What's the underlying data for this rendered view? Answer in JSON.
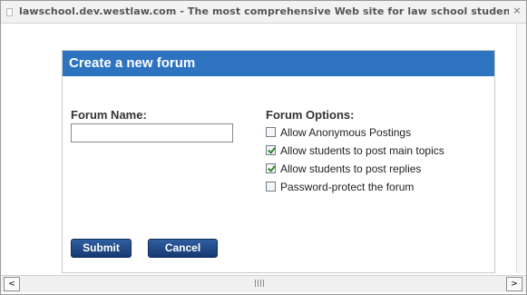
{
  "window": {
    "title": "lawschool.dev.westlaw.com - The most comprehensive Web site for law school students and faculty",
    "close_icon": "close-icon"
  },
  "dialog": {
    "title": "Create a new forum",
    "forum_name_label": "Forum Name:",
    "forum_name_value": "",
    "options_label": "Forum Options:",
    "options": [
      {
        "label": "Allow Anonymous Postings",
        "checked": false
      },
      {
        "label": "Allow students to post main topics",
        "checked": true
      },
      {
        "label": "Allow students to post replies",
        "checked": true
      },
      {
        "label": "Password-protect the forum",
        "checked": false
      }
    ],
    "submit_label": "Submit",
    "cancel_label": "Cancel"
  },
  "colors": {
    "header_bg": "#2e73c0",
    "button_bg": "#1f4a86",
    "check_color": "#2d8b2d"
  },
  "scrollbar": {
    "left_arrow": "<",
    "right_arrow": ">"
  }
}
